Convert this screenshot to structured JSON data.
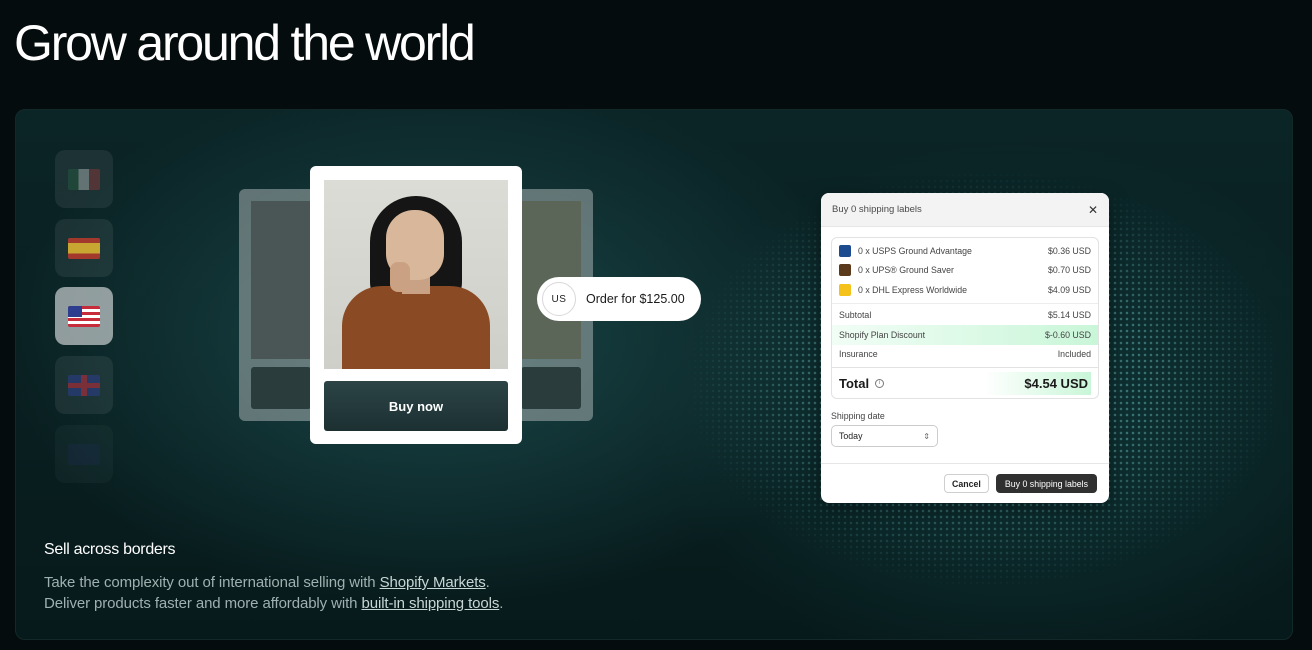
{
  "headline": "Grow around the world",
  "flags": [
    {
      "country": "Mexico",
      "icon": "mexico-flag-icon"
    },
    {
      "country": "Spain",
      "icon": "spain-flag-icon"
    },
    {
      "country": "United States",
      "icon": "us-flag-icon",
      "selected": true
    },
    {
      "country": "United Kingdom",
      "icon": "uk-flag-icon"
    },
    {
      "country": "Australia",
      "icon": "australia-flag-icon"
    }
  ],
  "product_card": {
    "button_label": "Buy now"
  },
  "order_pill": {
    "country_code": "US",
    "text": "Order for $125.00"
  },
  "modal": {
    "title": "Buy 0 shipping labels",
    "close_icon": "close-icon",
    "lines": [
      {
        "label": "0 x USPS Ground Advantage",
        "amount": "$0.36 USD",
        "icon": "usps-icon"
      },
      {
        "label": "0 x UPS® Ground Saver",
        "amount": "$0.70 USD",
        "icon": "ups-icon"
      },
      {
        "label": "0 x DHL Express Worldwide",
        "amount": "$4.09 USD",
        "icon": "dhl-icon"
      }
    ],
    "subtotal_label": "Subtotal",
    "subtotal_amount": "$5.14 USD",
    "discount_label": "Shopify Plan Discount",
    "discount_amount": "$-0.60 USD",
    "insurance_label": "Insurance",
    "insurance_value": "Included",
    "total_label": "Total",
    "total_amount": "$4.54 USD",
    "shipping_date_label": "Shipping date",
    "shipping_date_value": "Today",
    "cancel_label": "Cancel",
    "primary_label": "Buy 0 shipping labels",
    "accent_color": "#c9f6d8"
  },
  "copy": {
    "heading": "Sell across borders",
    "line1_prefix": "Take the complexity out of international selling with ",
    "line1_link": "Shopify Markets",
    "line1_suffix": ".",
    "line2_prefix": "Deliver products faster and more affordably with ",
    "line2_link": "built-in shipping tools",
    "line2_suffix": "."
  }
}
